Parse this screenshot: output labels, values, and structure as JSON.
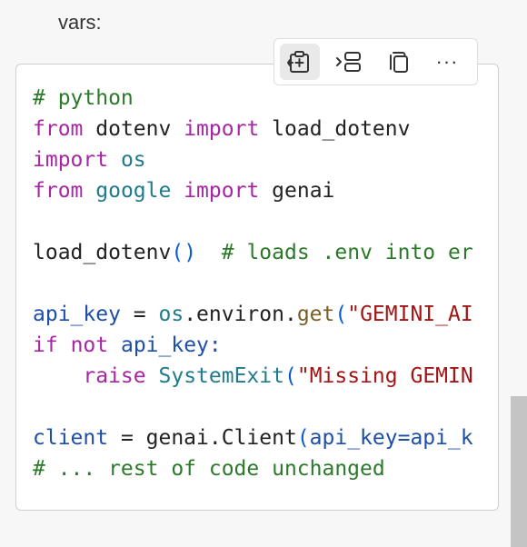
{
  "intro_text": "vars:",
  "toolbar": {
    "buttons": [
      {
        "name": "insert-code",
        "icon": "clipboard-insert-icon"
      },
      {
        "name": "apply-code",
        "icon": "apply-to-editor-icon"
      },
      {
        "name": "copy-code",
        "icon": "copy-icon"
      },
      {
        "name": "more-options",
        "icon": "ellipsis-icon",
        "label": "···"
      }
    ]
  },
  "code": {
    "language": "python",
    "lines": {
      "l1": {
        "comment": "# python"
      },
      "l2": {
        "from": "from",
        "module": "dotenv",
        "import": "import",
        "name": "load_dotenv"
      },
      "l3": {
        "import": "import",
        "module": "os"
      },
      "l4": {
        "from": "from",
        "module": "google",
        "import": "import",
        "name": "genai"
      },
      "l6": {
        "call": "load_dotenv",
        "open": "(",
        "close": ")",
        "comment": "# loads .env into er"
      },
      "l8": {
        "var": "api_key",
        "eq": " = ",
        "obj": "os",
        "dot": ".environ.",
        "fn": "get",
        "open": "(",
        "str": "\"GEMINI_AI"
      },
      "l9": {
        "if": "if",
        "not": "not",
        "rest": "api_key:"
      },
      "l10": {
        "raise": "raise",
        "exc": "SystemExit",
        "open": "(",
        "str": "\"Missing GEMIN"
      },
      "l12": {
        "var": "client",
        "eq": " = ",
        "rest": "genai.Client",
        "open": "(",
        "args": "api_key=api_k"
      },
      "l13": {
        "comment": "# ... rest of code unchanged"
      }
    }
  },
  "colors": {
    "keyword": "#a626a4",
    "control_keyword": "#1e4fa8",
    "module": "#1f7a8c",
    "comment": "#2a7a2a",
    "string": "#a31515",
    "paren": "#0b5bd3"
  }
}
